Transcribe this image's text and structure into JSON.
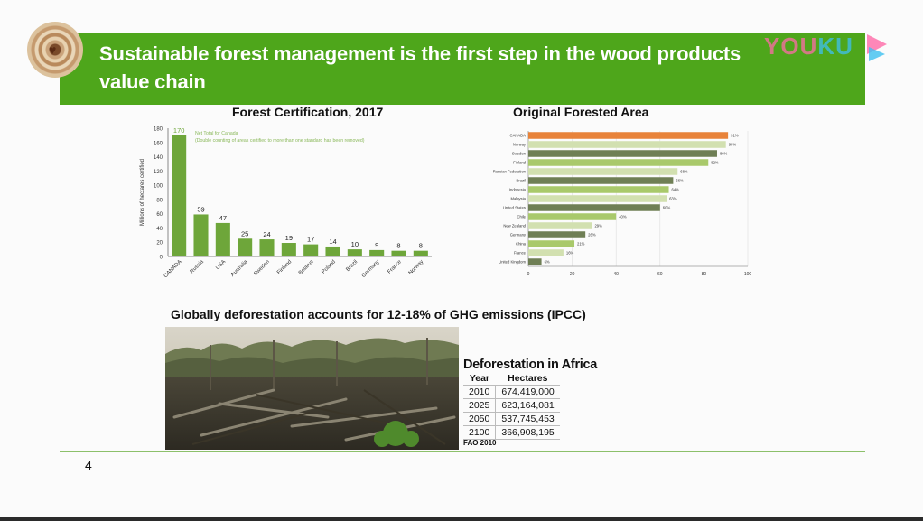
{
  "slide": {
    "title": "Sustainable forest management is the first step in the wood products value chain",
    "watermark": {
      "you": "YOU",
      "ku": "KU"
    },
    "page_number": "4"
  },
  "colors": {
    "title_bar": "#4ea61b",
    "cert_bar": "#6ea63a",
    "canada_bar": "#e8833a",
    "hbar_dark": "#6f7f55",
    "hbar_mid": "#a9c96b",
    "hbar_light": "#d2e0b0",
    "footer_line": "#8cc06a"
  },
  "cert_chart": {
    "title": "Forest Certification, 2017",
    "ylabel": "Millions of hectares certified",
    "note_line1": "Net Total for Canada",
    "note_line2": "(Double counting of areas certified to more than one standard has been removed)"
  },
  "forest_chart": {
    "title": "Original Forested Area"
  },
  "chart_data": [
    {
      "type": "bar",
      "title": "Forest Certification, 2017",
      "ylabel": "Millions of hectares certified",
      "categories": [
        "CANADA",
        "Russia",
        "USA",
        "Australia",
        "Sweden",
        "Finland",
        "Belarus",
        "Poland",
        "Brazil",
        "Germany",
        "France",
        "Norway"
      ],
      "values": [
        170,
        59,
        47,
        25,
        24,
        19,
        17,
        14,
        10,
        9,
        8,
        8
      ],
      "yticks": [
        0,
        20,
        40,
        60,
        80,
        100,
        120,
        140,
        160,
        180
      ],
      "ylim": [
        0,
        180
      ]
    },
    {
      "type": "bar",
      "orientation": "horizontal",
      "title": "Original Forested Area",
      "categories": [
        "CANADA",
        "Norway",
        "Sweden",
        "Finland",
        "Russian Federation",
        "Brazil",
        "Indonesia",
        "Malaysia",
        "United States",
        "Chile",
        "New Zealand",
        "Germany",
        "China",
        "France",
        "United Kingdom"
      ],
      "values": [
        91,
        90,
        86,
        82,
        68,
        66,
        64,
        63,
        60,
        40,
        29,
        26,
        21,
        16,
        6
      ],
      "xticks": [
        0,
        20,
        40,
        60,
        80,
        100
      ],
      "xlim": [
        0,
        100
      ]
    }
  ],
  "deforestation": {
    "headline": "Globally deforestation accounts for 12-18% of  GHG emissions  (IPCC)",
    "table_title": "Deforestation in Africa",
    "columns": [
      "Year",
      "Hectares"
    ],
    "rows": [
      [
        "2010",
        "674,419,000"
      ],
      [
        "2025",
        "623,164,081"
      ],
      [
        "2050",
        "537,745,453"
      ],
      [
        "2100",
        "366,908,195"
      ]
    ],
    "source": "FAO 2010"
  }
}
